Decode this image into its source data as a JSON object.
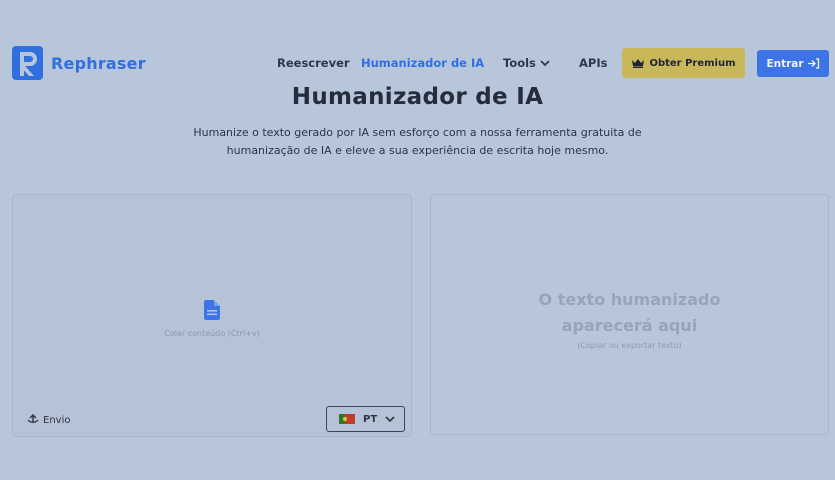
{
  "brand": {
    "name": "Rephraser",
    "color": "#2f6fe0"
  },
  "nav": {
    "links": [
      {
        "label": "Reescrever"
      },
      {
        "label": "Humanizador de IA",
        "active": true
      },
      {
        "label": "Tools"
      },
      {
        "label": "APIs"
      }
    ],
    "premium_label": "Obter Premium",
    "login_label": "Entrar"
  },
  "hero": {
    "title": "Humanizador de IA",
    "subtitle_line1": "Humanize o texto gerado por IA sem esforço com a nossa ferramenta gratuita de",
    "subtitle_line2": "humanização de IA e eleve a sua experiência de escrita hoje mesmo."
  },
  "input_panel": {
    "paste_hint": "Colar conteúdo (Ctrl+v)",
    "upload_label": "Envio",
    "language": {
      "code": "PT"
    },
    "icon": "document-icon"
  },
  "output_panel": {
    "placeholder_line1": "O texto humanizado",
    "placeholder_line2": "aparecerá aqui",
    "hint": "(Copiar ou exportar texto)"
  },
  "colors": {
    "accent": "#3d74e5",
    "premium": "#c9b85a",
    "background": "#b9c5d8"
  }
}
